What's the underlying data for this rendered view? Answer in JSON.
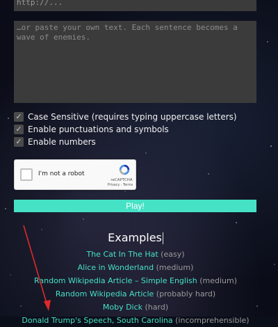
{
  "url_input": {
    "placeholder": "http://..."
  },
  "custom_text": {
    "placeholder": "…or paste your own text. Each sentence becomes a wave of enemies."
  },
  "options": [
    {
      "label": "Case Sensitive (requires typing uppercase letters)",
      "checked": true
    },
    {
      "label": "Enable punctuations and symbols",
      "checked": true
    },
    {
      "label": "Enable numbers",
      "checked": true
    }
  ],
  "captcha": {
    "label": "I'm not a robot",
    "brand": "reCAPTCHA",
    "links": "Privacy - Terms"
  },
  "play_button": {
    "label": "Play!"
  },
  "examples": {
    "title": "Examples",
    "items": [
      {
        "title": "The Cat In The Hat",
        "difficulty": "(easy)"
      },
      {
        "title": "Alice in Wonderland",
        "difficulty": "(medium)"
      },
      {
        "title": "Random Wikipedia Article – Simple English",
        "difficulty": "(medium)"
      },
      {
        "title": "Random Wikipedia Article",
        "difficulty": "(probably hard)"
      },
      {
        "title": "Moby Dick",
        "difficulty": "(hard)"
      },
      {
        "title": "Donald Trump's Speech, South Carolina",
        "difficulty": "(incomprehensible)"
      }
    ]
  },
  "colors": {
    "accent": "#46e2c6",
    "annotation": "#e0282a",
    "field_bg": "#3b3b3b"
  }
}
